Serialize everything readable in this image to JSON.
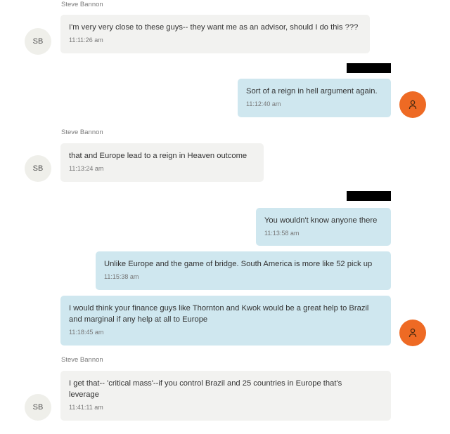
{
  "messages": [
    {
      "sender": "Steve Bannon",
      "avatar": "SB",
      "text": "I'm very very close to these guys-- they want me as an advisor, should I do this ???",
      "time": "11:11:26 am"
    },
    {
      "text": "Sort of a reign in hell argument again.",
      "time": "11:12:40 am",
      "avatar_icon": "user-icon"
    },
    {
      "sender": "Steve Bannon",
      "avatar": "SB",
      "text": "that and Europe lead to a reign in Heaven outcome",
      "time": "11:13:24 am"
    },
    {
      "text": "You wouldn't know anyone there",
      "time": "11:13:58 am"
    },
    {
      "text": "Unlike Europe and the game of bridge.  South America is more like 52 pick up",
      "time": "11:15:38 am"
    },
    {
      "text": "I would think your finance guys like Thornton and Kwok would be a great help to Brazil and marginal if any help at all to Europe",
      "time": "11:18:45 am",
      "avatar_icon": "user-icon"
    },
    {
      "sender": "Steve Bannon",
      "avatar": "SB",
      "text": "I get that-- 'critical mass'--if you control Brazil and 25 countries in Europe that's leverage",
      "time": "11:41:11 am"
    }
  ],
  "colors": {
    "incoming_bubble": "#f2f2f0",
    "outgoing_bubble": "#cfe7ef",
    "own_avatar": "#ee6a24",
    "redaction": "#000000"
  }
}
